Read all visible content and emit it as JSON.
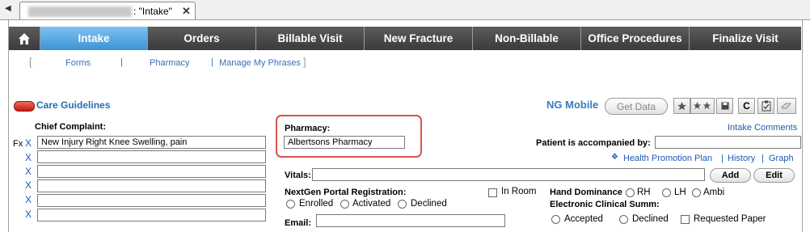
{
  "tabstrip": {
    "document_tab": ": \"Intake\"",
    "close": "✕",
    "scroll_left": "◀"
  },
  "nav": {
    "tabs": [
      {
        "label": "Intake"
      },
      {
        "label": "Orders"
      },
      {
        "label": "Billable Visit"
      },
      {
        "label": "New Fracture"
      },
      {
        "label": "Non-Billable"
      },
      {
        "label": "Office Procedures"
      },
      {
        "label": "Finalize Visit"
      }
    ]
  },
  "subnav": {
    "bracket_open": "[",
    "bracket_close": "]",
    "items": [
      "Forms",
      "Pharmacy",
      "Manage My Phrases"
    ],
    "separator": "|"
  },
  "care_guidelines": {
    "label": "Care Guidelines",
    "accent": "#d0231e"
  },
  "ng_mobile": {
    "label": "NG Mobile",
    "get_data": "Get Data"
  },
  "toolbar": {
    "icons": [
      "star-icon",
      "stars-icon",
      "save-icon",
      "refresh-icon",
      "clipboard-check-icon",
      "eraser-icon"
    ],
    "refresh_glyph": "C"
  },
  "intake_comments": "Intake Comments",
  "chief_complaint": {
    "label": "Chief Complaint:",
    "prefix": "Fx",
    "delete_label": "X",
    "rows": [
      "New Injury Right Knee Swelling, pain",
      "",
      "",
      "",
      "",
      ""
    ]
  },
  "pharmacy": {
    "label": "Pharmacy:",
    "value": "Albertsons Pharmacy",
    "highlight": "#d9534f"
  },
  "accompanied": {
    "label": "Patient is accompanied by:",
    "value": ""
  },
  "health_links": {
    "diamond": "❖",
    "promotion": "Health Promotion Plan",
    "sep": "|",
    "history": "History",
    "graph": "Graph"
  },
  "vitals": {
    "label": "Vitals:",
    "value": "",
    "add": "Add",
    "edit": "Edit"
  },
  "portal": {
    "label": "NextGen Portal Registration:",
    "options": [
      "Enrolled",
      "Activated",
      "Declined"
    ],
    "in_room": "In Room"
  },
  "email": {
    "label": "Email:",
    "value": ""
  },
  "hand_dominance": {
    "label": "Hand Dominance",
    "options": [
      "RH",
      "LH",
      "Ambi"
    ]
  },
  "clinical_summ": {
    "label": "Electronic Clinical Summ:",
    "options": [
      "Accepted",
      "Declined"
    ],
    "requested_paper": "Requested Paper"
  }
}
